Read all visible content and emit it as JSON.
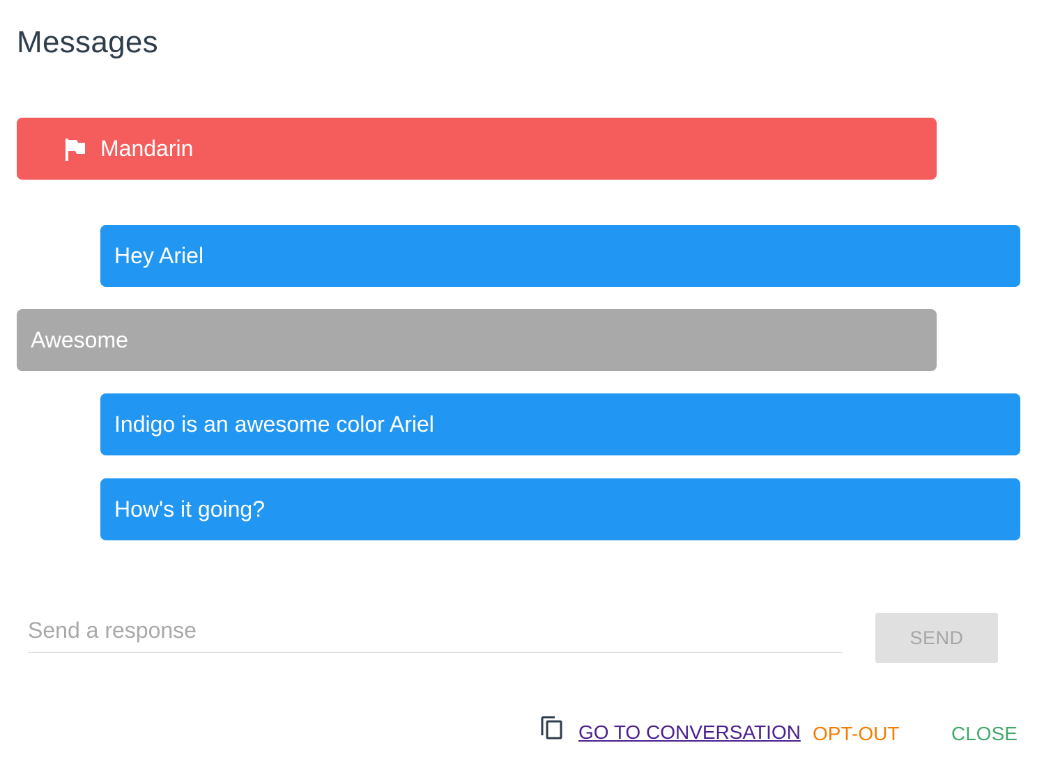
{
  "title": "Messages",
  "messages": [
    {
      "text": "Mandarin",
      "kind": "flagged",
      "icon": "flag-icon"
    },
    {
      "text": "Hey Ariel",
      "kind": "outgoing"
    },
    {
      "text": "Awesome",
      "kind": "incoming"
    },
    {
      "text": "Indigo is an awesome color Ariel",
      "kind": "outgoing"
    },
    {
      "text": "How's it going?",
      "kind": "outgoing"
    }
  ],
  "composer": {
    "placeholder": "Send a response",
    "value": "",
    "send_label": "SEND"
  },
  "footer": {
    "copy_icon": "copy-icon",
    "go_to_label": "GO TO CONVERSATION",
    "opt_out_label": "OPT-OUT",
    "close_label": "CLOSE"
  },
  "colors": {
    "flagged": "#f45d5c",
    "outgoing": "#2196f3",
    "incoming": "#a9a9a9",
    "link": "#4a1f8f",
    "opt_out": "#f57c00",
    "close": "#43a86b"
  }
}
